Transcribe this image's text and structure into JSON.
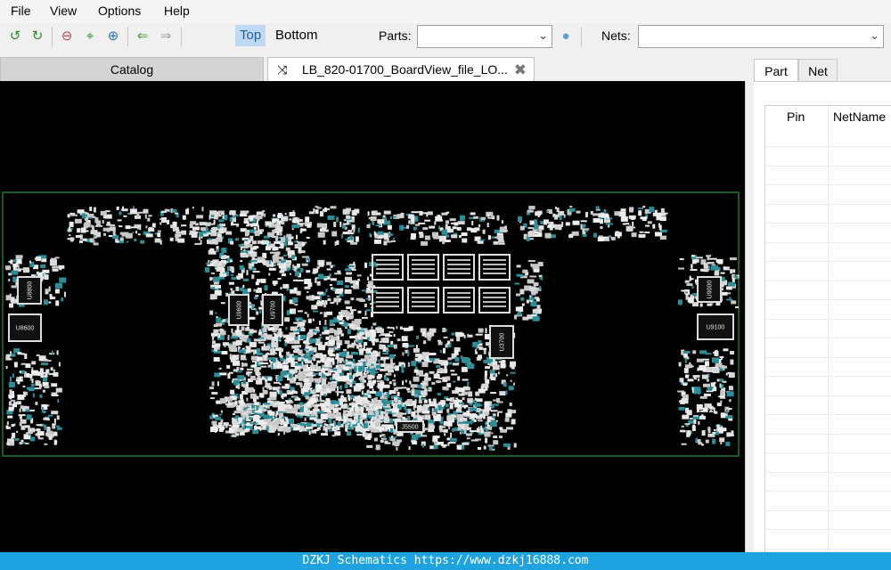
{
  "menu": {
    "file": "File",
    "view": "View",
    "options": "Options",
    "help": "Help"
  },
  "toolbar": {
    "icons": [
      "rotate-left-icon",
      "rotate-right-icon",
      "zoom-out-icon",
      "fit-icon",
      "zoom-in-icon",
      "back-arrow-icon",
      "forward-arrow-icon",
      "bulb-icon"
    ],
    "top_label": "Top",
    "bottom_label": "Bottom",
    "parts_label": "Parts:",
    "parts_value": "",
    "nets_label": "Nets:",
    "nets_value": "",
    "active_side": "Top",
    "accent_color": "#bfd9f3"
  },
  "tabs": {
    "catalog": "Catalog",
    "board_file": "LB_820-01700_BoardView_file_LO..."
  },
  "board": {
    "chip_labels": [
      "U8800",
      "U8600",
      "U9600",
      "U9700",
      "U3700",
      "U9000",
      "U9100",
      "J5500"
    ],
    "outline_color": "#1f7a2a"
  },
  "right_panel": {
    "tab_part": "Part",
    "tab_net": "Net",
    "col_pin": "Pin",
    "col_netname": "NetName"
  },
  "footer": {
    "text": "DZKJ Schematics https://www.dzkj16888.com"
  }
}
